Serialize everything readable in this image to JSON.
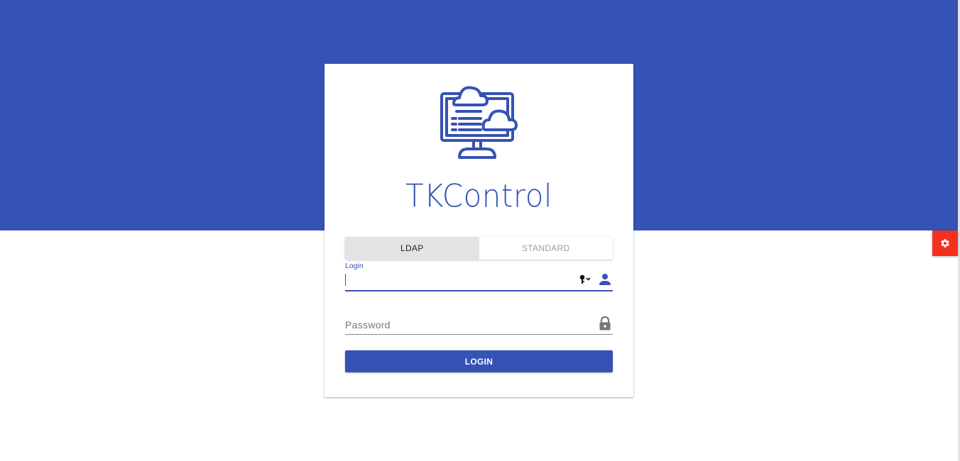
{
  "app": {
    "title": "TKControl"
  },
  "auth_tabs": [
    {
      "label": "LDAP",
      "active": true
    },
    {
      "label": "STANDARD",
      "active": false
    }
  ],
  "login_field": {
    "label": "Login",
    "value": ""
  },
  "password_field": {
    "placeholder": "Password",
    "value": ""
  },
  "login_button": {
    "label": "LOGIN"
  },
  "icons": {
    "logo": "monitor-cloud-icon",
    "key": "key-dropdown-icon",
    "user": "user-icon",
    "lock": "lock-icon",
    "settings": "gear-icon"
  },
  "colors": {
    "brand": "#3552b5",
    "settings_fab": "#f4301e",
    "tab_active_bg": "#e3e3e3"
  }
}
